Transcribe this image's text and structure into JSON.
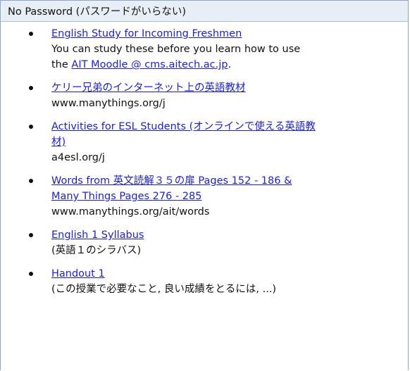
{
  "panel": {
    "title": "No Password (パスワードがいらない)"
  },
  "items": [
    {
      "link": "English Study for Incoming Freshmen",
      "desc_line1": "You can study these before you learn how to use",
      "desc_prefix": "the ",
      "inline_link": "AIT Moodle @ cms.aitech.ac.jp",
      "desc_suffix": "."
    },
    {
      "link": "ケリー兄弟のインターネット上の英語教材",
      "desc": "www.manythings.org/j"
    },
    {
      "link_line1": "Activities for ESL Students (オンラインで使える英語教",
      "link_line2": "材)",
      "desc": "a4esl.org/j"
    },
    {
      "link_line1": "Words from 英文読解３５の扉 Pages 152 - 186 &",
      "link_line2": "Many Things Pages 276 - 285",
      "desc": "www.manythings.org/ait/words"
    },
    {
      "link": "English 1 Syllabus",
      "desc": "(英語１のシラバス)"
    },
    {
      "link": "Handout 1",
      "desc": "(この授業で必要なこと, 良い成績をとるには, ...)"
    }
  ]
}
